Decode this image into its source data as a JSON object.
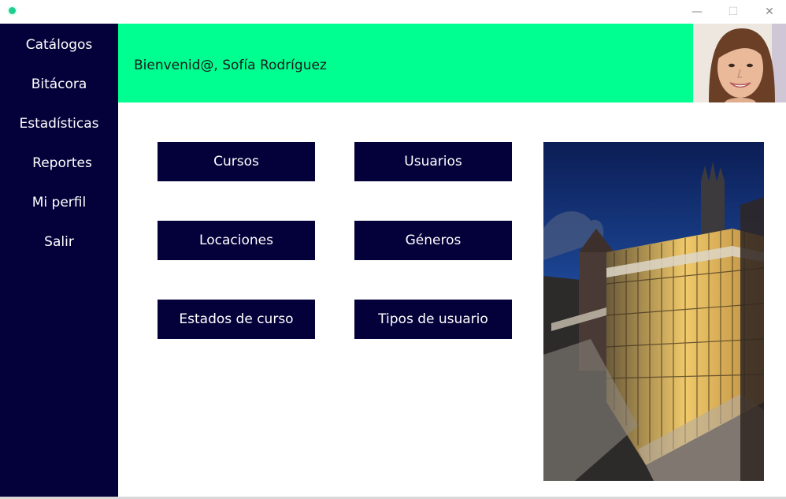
{
  "window": {
    "minimize_glyph": "—",
    "maximize_glyph": "☐",
    "close_glyph": "✕"
  },
  "sidebar": {
    "items": [
      {
        "label": "Catálogos"
      },
      {
        "label": "Bitácora"
      },
      {
        "label": "Estadísticas"
      },
      {
        "label": "Reportes"
      },
      {
        "label": "Mi perfil"
      },
      {
        "label": "Salir"
      }
    ]
  },
  "header": {
    "welcome_text": "Bienvenid@, Sofía Rodríguez",
    "background_color": "#00ff91"
  },
  "tiles": [
    {
      "label": "Cursos"
    },
    {
      "label": "Usuarios"
    },
    {
      "label": "Locaciones"
    },
    {
      "label": "Géneros"
    },
    {
      "label": "Estados de curso"
    },
    {
      "label": "Tipos de usuario"
    }
  ],
  "colors": {
    "sidebar_bg": "#04013a",
    "accent": "#00ff91",
    "tile_bg": "#04013a"
  }
}
